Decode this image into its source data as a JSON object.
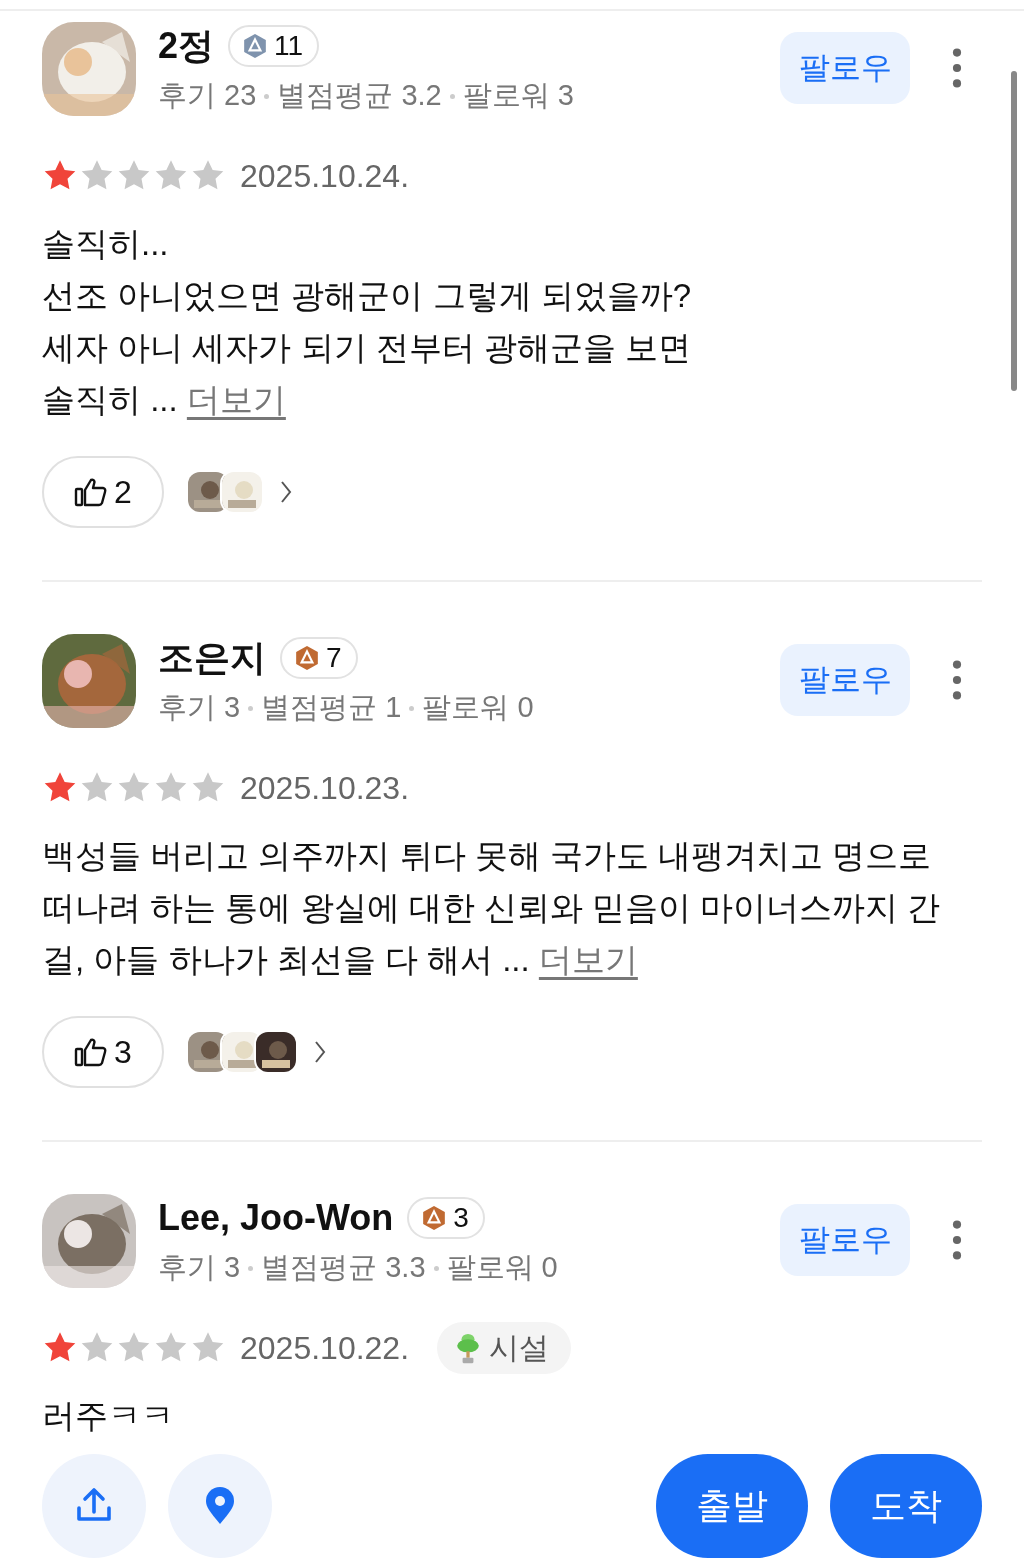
{
  "reviews": [
    {
      "name": "2정",
      "badge": {
        "kind": "silver",
        "count": "11"
      },
      "stats": [
        "후기 23",
        "별점평균 3.2",
        "팔로워 3"
      ],
      "follow": "팔로우",
      "stars": 1,
      "date": "2025.10.24.",
      "lines": [
        "솔직히...",
        "선조 아니었으면 광해군이 그렇게 되었을까?",
        "세자 아니 세자가 되기 전부터 광해군을 보면",
        "솔직히 ..."
      ],
      "more": "더보기",
      "likes": "2",
      "reactors": [
        {
          "kind": "picture"
        },
        {
          "kind": "picture"
        }
      ]
    },
    {
      "name": "조은지",
      "badge": {
        "kind": "bronze",
        "count": "7"
      },
      "stats": [
        "후기 3",
        "별점평균 1",
        "팔로워 0"
      ],
      "follow": "팔로우",
      "stars": 1,
      "date": "2025.10.23.",
      "lines": [
        "백성들 버리고 의주까지 튀다 못해 국가도 내팽겨치고 명으로",
        "떠나려 하는 통에 왕실에 대한 신뢰와 믿음이 마이너스까지 간",
        "걸, 아들 하나가 최선을 다 해서 ..."
      ],
      "more": "더보기",
      "likes": "3",
      "reactors": [
        {
          "kind": "picture"
        },
        {
          "kind": "picture"
        },
        {
          "kind": "picture"
        }
      ]
    },
    {
      "name": "Lee, Joo-Won",
      "badge": {
        "kind": "bronze",
        "count": "3"
      },
      "stats": [
        "후기 3",
        "별점평균 3.3",
        "팔로워 0"
      ],
      "follow": "팔로우",
      "stars": 1,
      "date": "2025.10.22.",
      "tag": "시설",
      "lines": [
        "러주ㅋㅋ"
      ]
    }
  ],
  "bottom_bar": {
    "buttons": [
      "출발",
      "도착"
    ]
  }
}
